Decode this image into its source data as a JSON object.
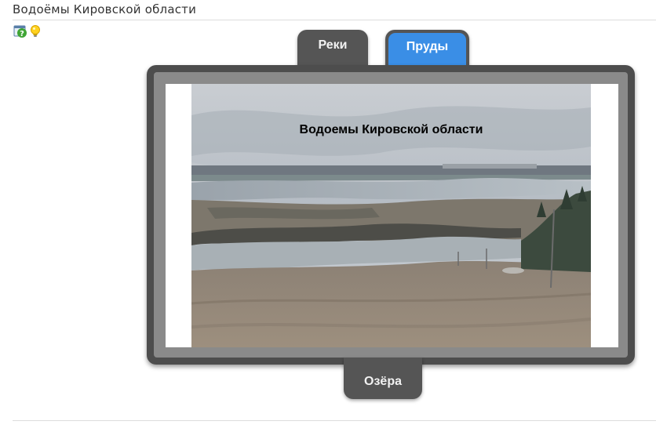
{
  "page": {
    "title": "Водоёмы Кировской области"
  },
  "toolbar": {
    "icons": [
      "help-icon",
      "lightbulb-icon"
    ]
  },
  "tabs": {
    "rivers": "Реки",
    "ponds": "Пруды",
    "lakes": "Озёра",
    "active": "ponds"
  },
  "slide": {
    "caption": "Водоемы Кировской области"
  },
  "colors": {
    "frame": "#4d4d4d",
    "tab": "#555555",
    "active_tab": "#3a8ee6"
  }
}
